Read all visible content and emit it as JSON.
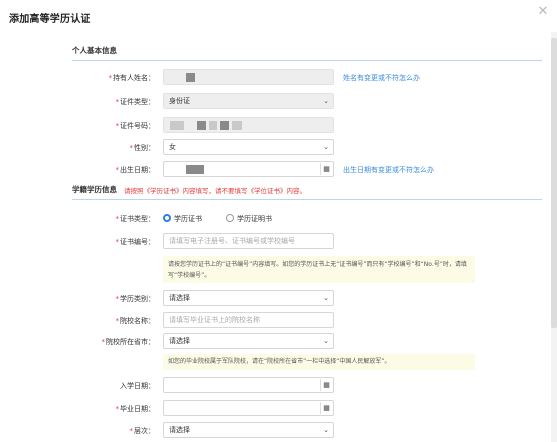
{
  "dialog": {
    "title": "添加高等学历认证",
    "close_glyph": "✕"
  },
  "personal": {
    "section_title": "个人基本信息",
    "name_label": "持有人姓名",
    "name_change_link": "姓名有变更或不符怎么办",
    "id_type_label": "证件类型",
    "id_type_value": "身份证",
    "id_number_label": "证件号码",
    "gender_label": "性别",
    "gender_value": "女",
    "birth_label": "出生日期",
    "birth_change_link": "出生日期有变更或不符怎么办"
  },
  "education": {
    "section_title": "学籍学历信息",
    "section_hint": "请按照《学历证书》内容填写，请不要填写《学位证书》内容。",
    "cert_type_label": "证书类型",
    "cert_type_options": [
      "学历证书",
      "学历证明书"
    ],
    "cert_type_selected": "学历证书",
    "cert_no_label": "证书编号",
    "cert_no_placeholder": "请填写电子注册号、证书编号或学校编号",
    "cert_no_notice": "请按您学历证书上的“证书编号”内容填写。如您的学历证书上无“证书编号”而只有“学校编号”和“No.号”时，请填写“学校编号”。",
    "level_type_label": "学历类别",
    "level_type_value": "请选择",
    "school_label": "院校名称",
    "school_placeholder": "请填写毕业证书上的院校名称",
    "province_label": "院校所在省市",
    "province_value": "请选择",
    "province_notice": "如您的毕业院校属于军队院校，请在“院校所在省市”一栏中选择“中国人民解放军”。",
    "enroll_label": "入学日期",
    "grad_label": "毕业日期",
    "tier_label": "层次",
    "tier_value": "请选择"
  },
  "common": {
    "required_mark": "*",
    "colon": "：",
    "caret": "⌄",
    "calendar_glyph": "▦"
  },
  "colors": {
    "accent": "#2a7fe0",
    "link": "#3a8de0",
    "required": "#e4393c",
    "notice_bg": "#fcfbe6"
  }
}
